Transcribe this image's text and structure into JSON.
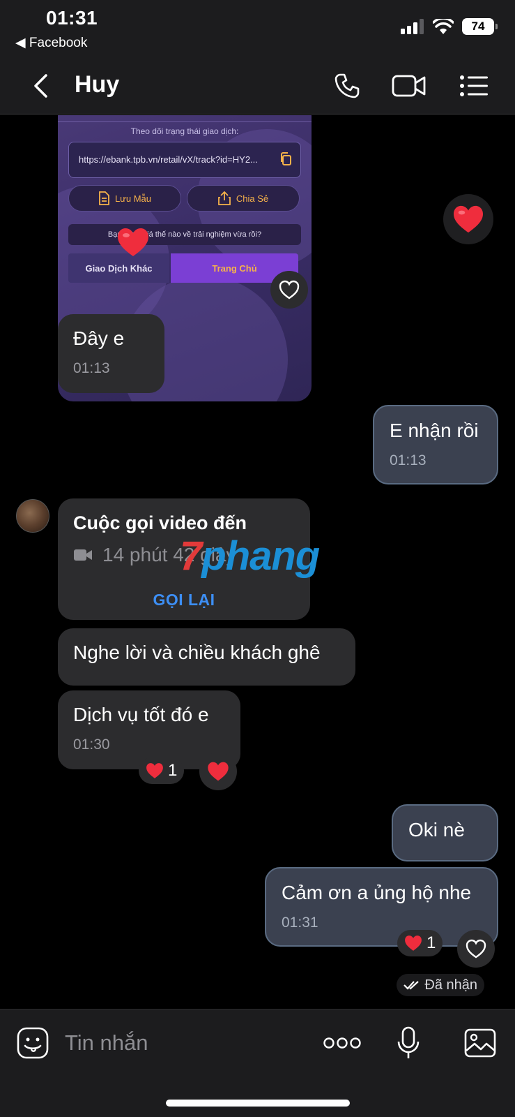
{
  "status_bar": {
    "time": "01:31",
    "back_app": "◀ Facebook",
    "battery": "74"
  },
  "header": {
    "title": "Huy",
    "icons": [
      "back-chevron-icon",
      "phone-icon",
      "video-camera-icon",
      "menu-list-icon"
    ]
  },
  "shared_image": {
    "track_label": "Theo dõi trạng thái giao dịch:",
    "track_url": "https://ebank.tpb.vn/retail/vX/track?id=HY2...",
    "save_template_label": "Lưu Mẫu",
    "share_label": "Chia Sẻ",
    "feedback_prompt": "Bạn đánh giá thế nào về trải nghiệm vừa rồi?",
    "other_transaction_label": "Giao Dịch Khác",
    "home_label": "Trang Chủ"
  },
  "messages": [
    {
      "direction": "incoming",
      "text": "Đây e",
      "time": "01:13"
    },
    {
      "direction": "outgoing",
      "text": "E nhận rồi",
      "time": "01:13"
    },
    {
      "direction": "incoming",
      "text": "Nghe lời và chiều khách ghê"
    },
    {
      "direction": "incoming",
      "text": "Dịch vụ tốt đó e",
      "time": "01:30",
      "reaction": "❤️",
      "reaction_count": "1"
    },
    {
      "direction": "outgoing",
      "text": "Oki nè"
    },
    {
      "direction": "outgoing",
      "text": "Cảm ơn a ủng hộ nhe",
      "time": "01:31",
      "reaction": "❤️",
      "reaction_count": "1"
    }
  ],
  "call": {
    "title": "Cuộc gọi video đến",
    "duration": "14 phút 42 giây",
    "callback_label": "GỌI LẠI"
  },
  "watermark": {
    "part1": "7",
    "part2": "phang"
  },
  "read_status": "Đã nhận",
  "composer": {
    "placeholder": "Tin nhắn",
    "icons": [
      "sticker-icon",
      "more-dots-icon",
      "microphone-icon",
      "gallery-icon"
    ]
  },
  "colors": {
    "background": "#000000",
    "incoming_bubble": "#2c2c2e",
    "outgoing_bubble": "#3b4150",
    "link_blue": "#3d8ff5",
    "heart_red": "#ef2d3d"
  }
}
